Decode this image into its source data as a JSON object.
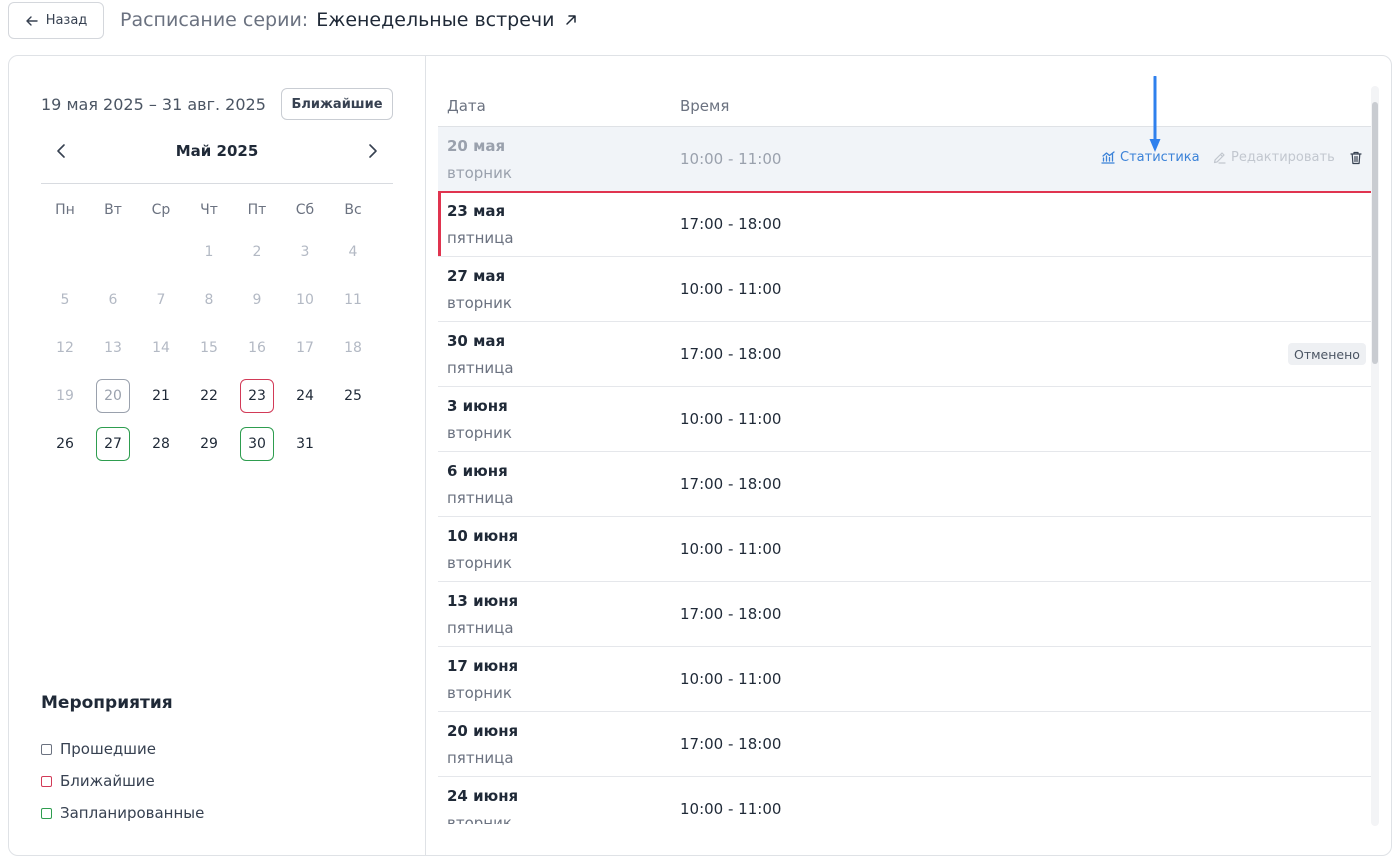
{
  "header": {
    "back_label": "Назад",
    "title_prefix": "Расписание серии:",
    "title_name": "Еженедельные встречи"
  },
  "calendar": {
    "range": "19 мая 2025 – 31 авг. 2025",
    "nearest_label": "Ближайшие",
    "month": "Май 2025",
    "weekdays": [
      "Пн",
      "Вт",
      "Ср",
      "Чт",
      "Пт",
      "Сб",
      "Вс"
    ],
    "days": [
      "1",
      "2",
      "3",
      "4",
      "5",
      "6",
      "7",
      "8",
      "9",
      "10",
      "11",
      "12",
      "13",
      "14",
      "15",
      "16",
      "17",
      "18",
      "19",
      "20",
      "21",
      "22",
      "23",
      "24",
      "25",
      "26",
      "27",
      "28",
      "29",
      "30",
      "31"
    ]
  },
  "legend": {
    "title": "Мероприятия",
    "items": [
      {
        "label": "Прошедшие",
        "status": "past"
      },
      {
        "label": "Ближайшие",
        "status": "upcoming"
      },
      {
        "label": "Запланированные",
        "status": "scheduled"
      }
    ]
  },
  "table": {
    "col_date": "Дата",
    "col_time": "Время",
    "rows": [
      {
        "date": "20 мая",
        "weekday": "вторник",
        "time": "10:00 - 11:00"
      },
      {
        "date": "23 мая",
        "weekday": "пятница",
        "time": "17:00 - 18:00"
      },
      {
        "date": "27 мая",
        "weekday": "вторник",
        "time": "10:00 - 11:00"
      },
      {
        "date": "30 мая",
        "weekday": "пятница",
        "time": "17:00 - 18:00",
        "badge": "Отменено"
      },
      {
        "date": "3 июня",
        "weekday": "вторник",
        "time": "10:00 - 11:00"
      },
      {
        "date": "6 июня",
        "weekday": "пятница",
        "time": "17:00 - 18:00"
      },
      {
        "date": "10 июня",
        "weekday": "вторник",
        "time": "10:00 - 11:00"
      },
      {
        "date": "13 июня",
        "weekday": "пятница",
        "time": "17:00 - 18:00"
      },
      {
        "date": "17 июня",
        "weekday": "вторник",
        "time": "10:00 - 11:00"
      },
      {
        "date": "20 июня",
        "weekday": "пятница",
        "time": "17:00 - 18:00"
      },
      {
        "date": "24 июня",
        "weekday": "вторник",
        "time": "10:00 - 11:00"
      }
    ],
    "actions": {
      "stats_label": "Статистика",
      "edit_label": "Редактировать"
    }
  },
  "colors": {
    "accent_blue": "#3b82d8",
    "upcoming_red": "#e0344f",
    "scheduled_green": "#2e9d4f"
  },
  "icons": [
    "arrow-left-icon",
    "external-link-icon",
    "chevron-left-icon",
    "chevron-right-icon",
    "chart-icon",
    "pencil-icon",
    "trash-icon"
  ]
}
